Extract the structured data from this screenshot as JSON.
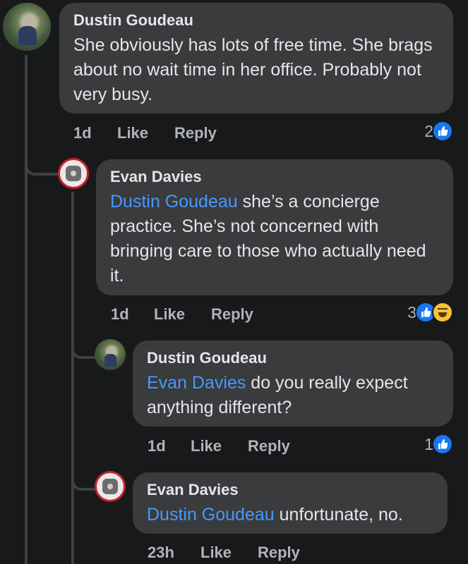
{
  "comments": [
    {
      "author": "Dustin Goudeau",
      "mention": "",
      "text": "She obviously has lots of free time. She brags about no wait time in her office. Probably not very busy.",
      "time": "1d",
      "like_label": "Like",
      "reply_label": "Reply",
      "reaction_count": "2",
      "reactions": [
        "like-icon"
      ]
    },
    {
      "author": "Evan Davies",
      "mention": "Dustin Goudeau",
      "text": " she’s a concierge practice. She’s not concerned with bringing care to those who actually need it.",
      "time": "1d",
      "like_label": "Like",
      "reply_label": "Reply",
      "reaction_count": "3",
      "reactions": [
        "like-icon",
        "haha-icon"
      ]
    },
    {
      "author": "Dustin Goudeau",
      "mention": "Evan Davies",
      "text": " do you really expect anything different?",
      "time": "1d",
      "like_label": "Like",
      "reply_label": "Reply",
      "reaction_count": "1",
      "reactions": [
        "like-icon"
      ]
    },
    {
      "author": "Evan Davies",
      "mention": "Dustin Goudeau",
      "text": " unfortunate, no.",
      "time": "23h",
      "like_label": "Like",
      "reply_label": "Reply",
      "reaction_count": "",
      "reactions": []
    }
  ],
  "colors": {
    "background": "#18191a",
    "bubble": "#3a3b3c",
    "mention": "#4599ff",
    "like": "#1877f2",
    "secondary_text": "#b0b3b8"
  }
}
